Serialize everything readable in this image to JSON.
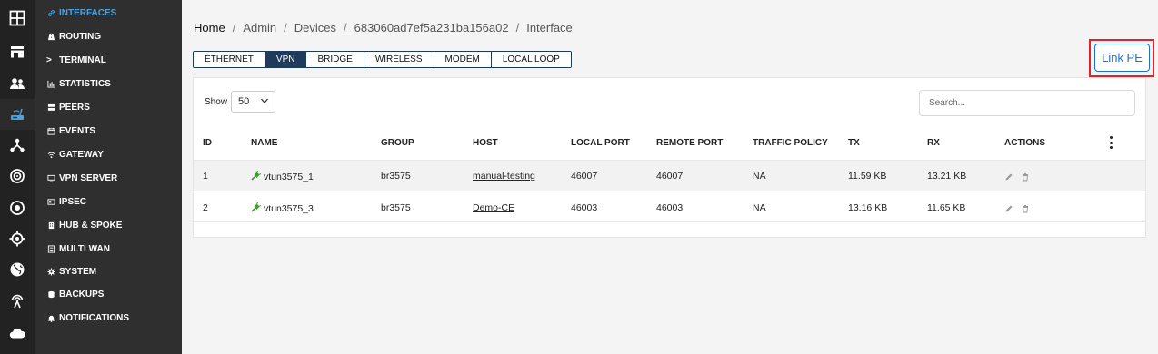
{
  "rail": {
    "icons": [
      "dashboard-icon",
      "store-icon",
      "users-icon",
      "router-icon",
      "network-tree-icon",
      "target-icon",
      "record-icon",
      "crosshair-icon",
      "globe-icon",
      "antenna-icon",
      "cloud-icon"
    ],
    "active_index": 3
  },
  "menu": {
    "items": [
      {
        "label": "INTERFACES",
        "icon": "link-icon",
        "active": true
      },
      {
        "label": "ROUTING",
        "icon": "road-icon"
      },
      {
        "label": ">_ TERMINAL",
        "icon": ""
      },
      {
        "label": "STATISTICS",
        "icon": "bar-chart-icon"
      },
      {
        "label": "PEERS",
        "icon": "server-icon"
      },
      {
        "label": "EVENTS",
        "icon": "calendar-icon"
      },
      {
        "label": "GATEWAY",
        "icon": "wifi-icon"
      },
      {
        "label": "VPN SERVER",
        "icon": "display-icon"
      },
      {
        "label": "IPSEC",
        "icon": "card-icon"
      },
      {
        "label": "HUB & SPOKE",
        "icon": "building-icon"
      },
      {
        "label": "MULTI WAN",
        "icon": "list-icon"
      },
      {
        "label": "SYSTEM",
        "icon": "gear-icon"
      },
      {
        "label": "BACKUPS",
        "icon": "database-icon"
      },
      {
        "label": "NOTIFICATIONS",
        "icon": "bell-icon"
      }
    ]
  },
  "breadcrumb": [
    "Home",
    "Admin",
    "Devices",
    "683060ad7ef5a231ba156a02",
    "Interface"
  ],
  "tabs": [
    "ETHERNET",
    "VPN",
    "BRIDGE",
    "WIRELESS",
    "MODEM",
    "LOCAL LOOP"
  ],
  "active_tab": "VPN",
  "link_pe_label": "Link PE",
  "show": {
    "label": "Show",
    "value": "50"
  },
  "search": {
    "placeholder": "Search..."
  },
  "columns": [
    "ID",
    "NAME",
    "GROUP",
    "HOST",
    "LOCAL PORT",
    "REMOTE PORT",
    "TRAFFIC POLICY",
    "TX",
    "RX",
    "ACTIONS"
  ],
  "rows": [
    {
      "id": "1",
      "name": "vtun3575_1",
      "group": "br3575",
      "host": "manual-testing",
      "local_port": "46007",
      "remote_port": "46007",
      "traffic_policy": "NA",
      "tx": "11.59 KB",
      "rx": "13.21 KB"
    },
    {
      "id": "2",
      "name": "vtun3575_3",
      "group": "br3575",
      "host": "Demo-CE",
      "local_port": "46003",
      "remote_port": "46003",
      "traffic_policy": "NA",
      "tx": "13.16 KB",
      "rx": "11.65 KB"
    }
  ],
  "colors": {
    "accent": "#4aa3df",
    "nav_dark": "#1f3b5c",
    "highlight_red": "#e0222b",
    "link_blue": "#1f6fd1",
    "plug_green": "#3aa02a"
  }
}
